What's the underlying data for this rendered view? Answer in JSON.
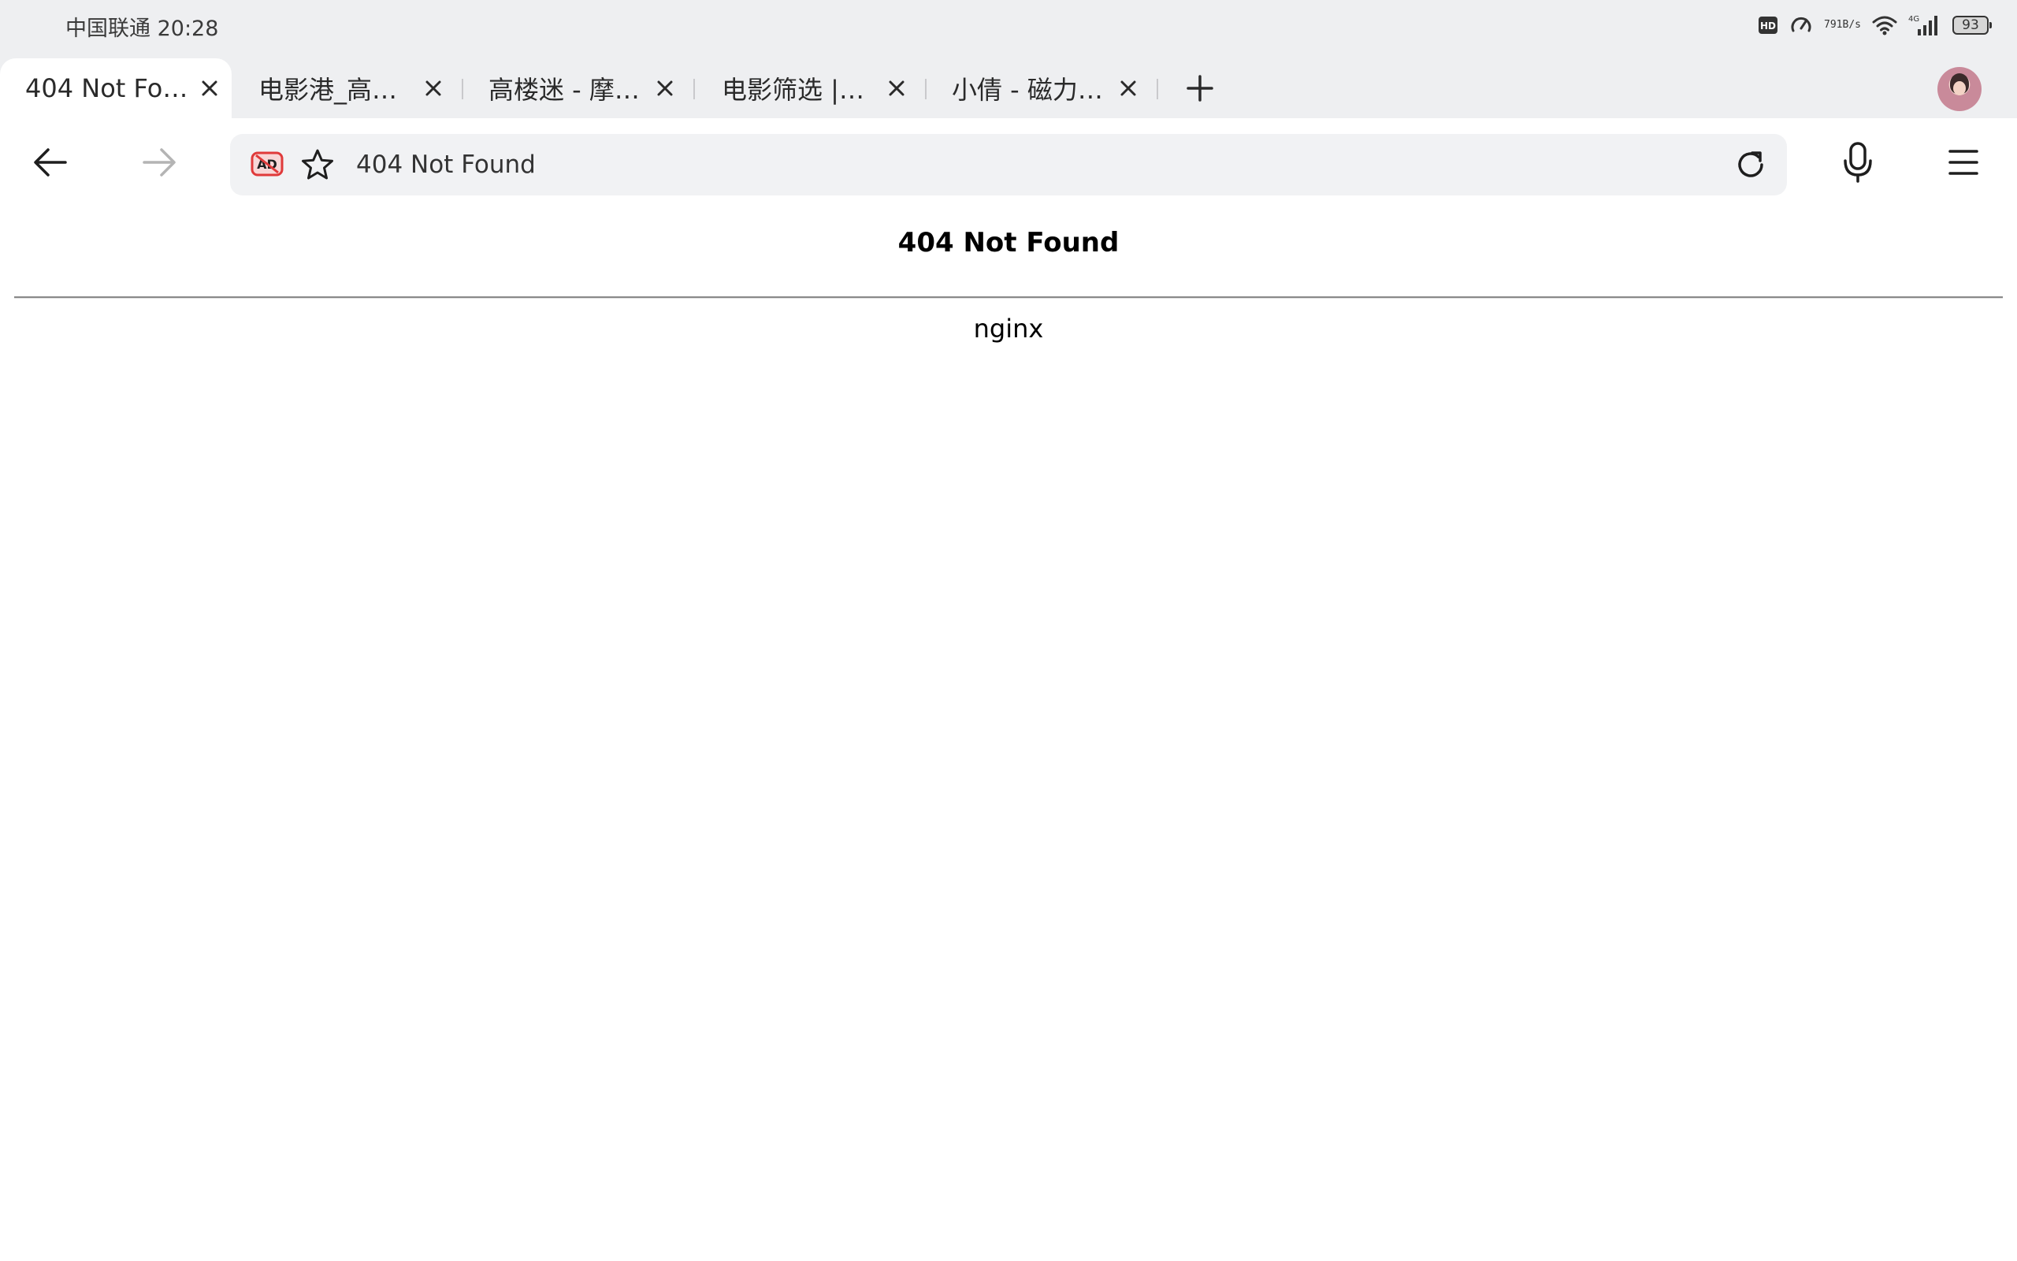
{
  "status_bar": {
    "carrier_time": "中国联通 20:28",
    "net_speed_value": "791",
    "net_speed_unit": "B/s",
    "network_label": "4G",
    "battery_level": "93"
  },
  "tabs": [
    {
      "title": "404 Not Fo…",
      "active": true
    },
    {
      "title": "电影港_高…",
      "active": false
    },
    {
      "title": "高楼迷 - 摩…",
      "active": false
    },
    {
      "title": "电影筛选 |…",
      "active": false
    },
    {
      "title": "小倩 - 磁力…",
      "active": false
    }
  ],
  "toolbar": {
    "address_text": "404 Not Found"
  },
  "page": {
    "heading": "404 Not Found",
    "server": "nginx"
  },
  "colors": {
    "chrome_bg": "#eeeff1",
    "omnibox_bg": "#f1f2f4",
    "adblock_red": "#e03a3a"
  }
}
